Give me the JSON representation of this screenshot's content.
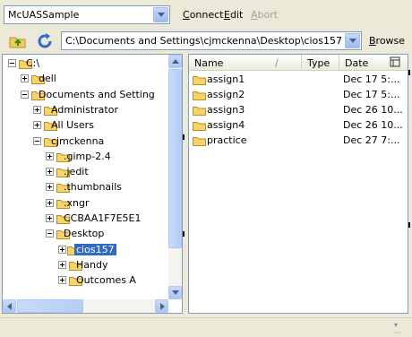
{
  "toolbar": {
    "site_combo": "McUASSample",
    "connect_label": "onnect",
    "connect_underline": "C",
    "edit_label": "dit",
    "edit_underline": "E",
    "abort_label": "bort",
    "abort_underline": "A",
    "path_value": "C:\\Documents and Settings\\cjmckenna\\Desktop\\cios157",
    "browse_label": "rowse",
    "browse_underline": "B"
  },
  "tree": {
    "items": [
      {
        "label": "C:\\",
        "indent": 0,
        "expander": "minus"
      },
      {
        "label": "dell",
        "indent": 1,
        "expander": "plus"
      },
      {
        "label": "Documents and Setting",
        "indent": 1,
        "expander": "minus"
      },
      {
        "label": "Administrator",
        "indent": 2,
        "expander": "plus"
      },
      {
        "label": "All Users",
        "indent": 2,
        "expander": "plus"
      },
      {
        "label": "cjmckenna",
        "indent": 2,
        "expander": "minus"
      },
      {
        "label": ".gimp-2.4",
        "indent": 3,
        "expander": "plus"
      },
      {
        "label": ".jedit",
        "indent": 3,
        "expander": "plus"
      },
      {
        "label": ".thumbnails",
        "indent": 3,
        "expander": "plus"
      },
      {
        "label": ".xngr",
        "indent": 3,
        "expander": "plus"
      },
      {
        "label": "CCBAA1F7E5E1",
        "indent": 3,
        "expander": "plus"
      },
      {
        "label": "Desktop",
        "indent": 3,
        "expander": "minus"
      },
      {
        "label": "cios157",
        "indent": 4,
        "expander": "plus",
        "selected": true
      },
      {
        "label": "Handy",
        "indent": 4,
        "expander": "plus"
      },
      {
        "label": "Outcomes A",
        "indent": 4,
        "expander": "plus"
      }
    ]
  },
  "list": {
    "headers": {
      "name": "Name",
      "sort": "/",
      "type": "Type",
      "date": "Date"
    },
    "rows": [
      {
        "name": "assign1",
        "date": "Dec 17 5:..."
      },
      {
        "name": "assign2",
        "date": "Dec 17 5:..."
      },
      {
        "name": "assign3",
        "date": "Dec 26 10..."
      },
      {
        "name": "assign4",
        "date": "Dec 26 10..."
      },
      {
        "name": "practice",
        "date": "Dec 27 7:..."
      }
    ]
  },
  "colors": {
    "folder": "#f7d36b",
    "selection": "#316ac5",
    "border": "#7f9db9"
  }
}
